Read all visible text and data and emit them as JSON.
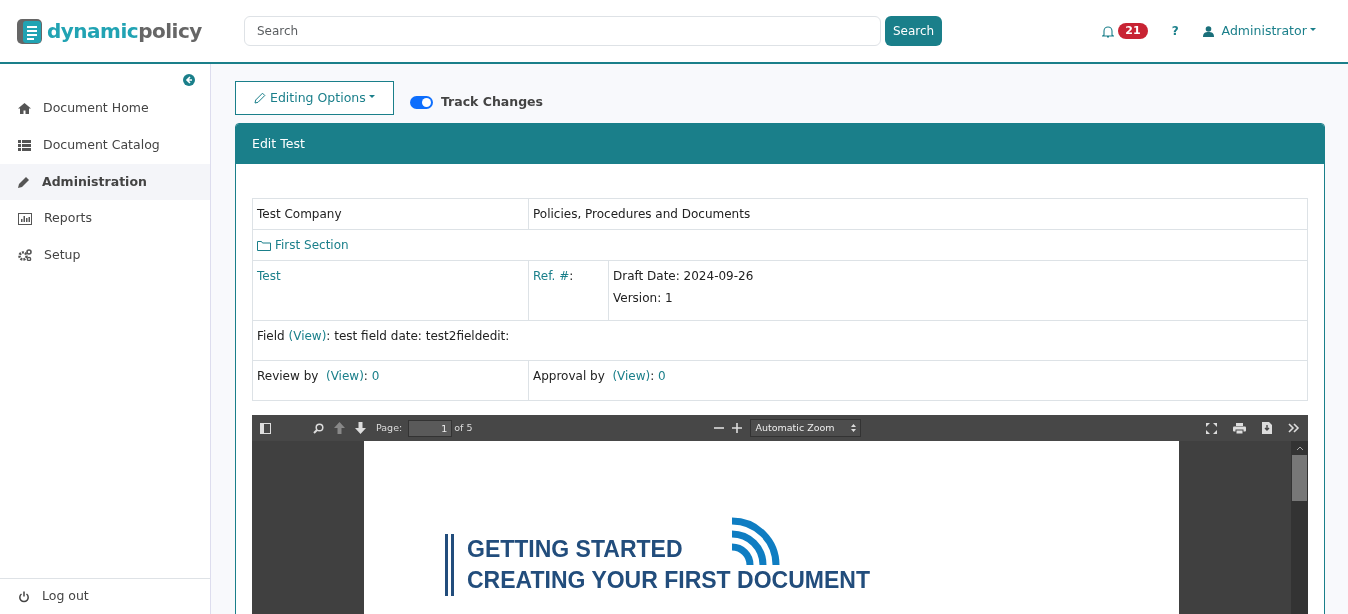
{
  "header": {
    "logo": {
      "part_1": "dynamic",
      "part_2": "policy"
    },
    "search": {
      "placeholder": "Search"
    },
    "search_button": "Search",
    "notifications": "21",
    "help": "?",
    "user": "Administrator"
  },
  "sidebar": {
    "items": [
      {
        "label": "Document Home",
        "selected": false
      },
      {
        "label": "Document Catalog",
        "selected": false
      },
      {
        "label": "Administration",
        "selected": true
      },
      {
        "label": "Reports",
        "selected": false
      },
      {
        "label": "Setup",
        "selected": false
      }
    ],
    "logout": "Log out"
  },
  "toolbar": {
    "editing_options": "Editing Options",
    "track_changes": {
      "label": "Track Changes",
      "on": true
    }
  },
  "card": {
    "title": "Edit Test",
    "company": "Test Company",
    "collection": "Policies, Procedures and Documents",
    "section": "First Section",
    "document": "Test",
    "ref_label": "Ref. #",
    "ref_suffix": ":",
    "draft_date": "Draft Date: 2024-09-26",
    "version": "Version: 1",
    "field": {
      "prefix": "Field ",
      "link": "(View)",
      "suffix": ": test field date: test2fieldedit:"
    },
    "review": {
      "label": "Review by  ",
      "link": "(View)",
      "sep": ": ",
      "count": "0"
    },
    "approval": {
      "label": "Approval by  ",
      "link": "(View)",
      "sep": ": ",
      "count": "0"
    }
  },
  "pdf_viewer": {
    "page_label": "Page:",
    "page": "1",
    "page_count": "of 5",
    "zoom": "Automatic Zoom",
    "heading_1": "GETTING STARTED",
    "heading_2": "CREATING YOUR FIRST DOCUMENT"
  }
}
